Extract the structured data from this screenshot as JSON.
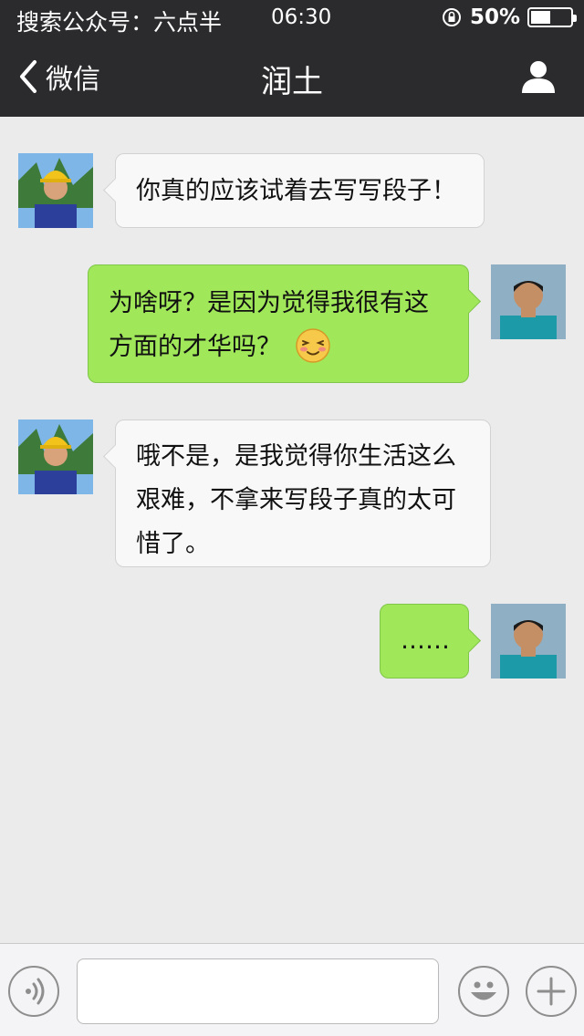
{
  "status_bar": {
    "carrier_text": "搜索公众号：六点半",
    "time": "06:30",
    "battery": "50%",
    "battery_level": 0.5
  },
  "nav": {
    "back_label": "微信",
    "title": "润土"
  },
  "messages": [
    {
      "sender": "runtu",
      "side": "left",
      "text": "你真的应该试着去写写段子！"
    },
    {
      "sender": "me",
      "side": "right",
      "text": "为啥呀？是因为觉得我很有这方面的才华吗？",
      "emoji": "blush-emoji"
    },
    {
      "sender": "runtu",
      "side": "left",
      "text": "哦不是，是我觉得你生活这么艰难，不拿来写段子真的太可惜了。"
    },
    {
      "sender": "me",
      "side": "right",
      "text": "……"
    }
  ],
  "input": {
    "value": "",
    "placeholder": ""
  },
  "icons": {
    "back": "chevron-left-icon",
    "contact": "person-icon",
    "voice": "voice-icon",
    "emoji": "smiley-icon",
    "more": "plus-icon"
  },
  "colors": {
    "nav_bg": "#2b2b2d",
    "chat_bg": "#ebebeb",
    "bubble_out": "#a0e75a",
    "bubble_in": "#f8f8f8"
  }
}
